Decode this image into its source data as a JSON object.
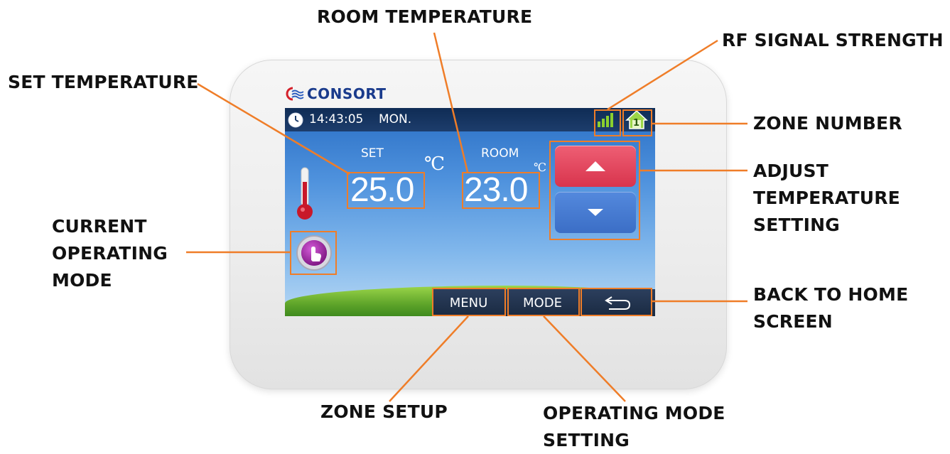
{
  "callouts": {
    "room_temperature": "ROOM TEMPERATURE",
    "rf_signal_strength": "RF SIGNAL STRENGTH",
    "set_temperature": "SET TEMPERATURE",
    "zone_number": "ZONE NUMBER",
    "adjust_line1": "ADJUST",
    "adjust_line2": "TEMPERATURE",
    "adjust_line3": "SETTING",
    "mode_line1": "CURRENT",
    "mode_line2": "OPERATING",
    "mode_line3": "MODE",
    "back_line1": "BACK TO HOME",
    "back_line2": "SCREEN",
    "zone_setup": "ZONE SETUP",
    "opmode_line1": "OPERATING MODE",
    "opmode_line2": "SETTING"
  },
  "device": {
    "brand": "CONSORT",
    "brand_color": "#1a3b8c"
  },
  "screen": {
    "time": "14:43:05",
    "day": "MON.",
    "zone": "1",
    "set_label": "SET",
    "set_value": "25.0",
    "set_unit": "℃",
    "room_label": "ROOM",
    "room_value": "23.0",
    "room_unit": "℃",
    "buttons": {
      "menu": "MENU",
      "mode": "MODE",
      "back_icon": "return-arrow-icon"
    }
  },
  "colors": {
    "highlight": "#ef7d28",
    "up_button": "#e0405a",
    "down_button": "#4178cf"
  }
}
